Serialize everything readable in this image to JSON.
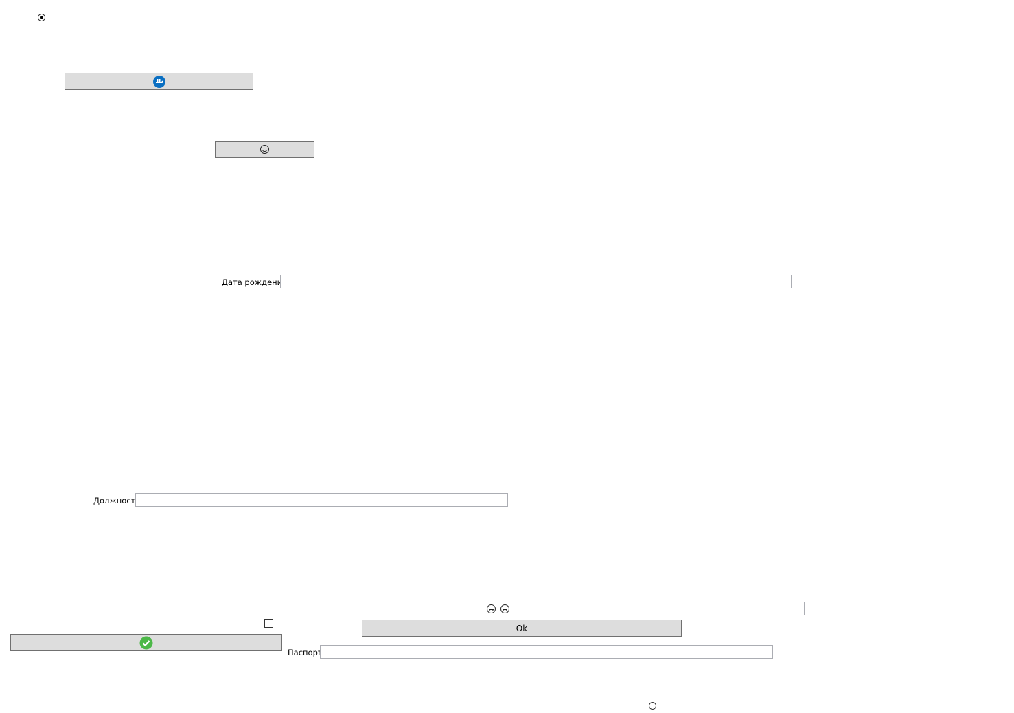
{
  "radios": [
    {
      "checked": true
    },
    {
      "checked": false
    }
  ],
  "checkbox": {
    "checked": false
  },
  "buttons": {
    "refresh": {
      "icon": "refresh-icon",
      "color": "#0a6fc2"
    },
    "emoji_button": {
      "icon": "laughing-emoji-icon"
    },
    "ok": {
      "label": "Ok"
    },
    "confirm": {
      "icon": "check-circle-icon",
      "color": "#4cb848"
    }
  },
  "fields": {
    "birth_date": {
      "label": "Дата рождения",
      "value": ""
    },
    "position": {
      "label": "Должность",
      "value": ""
    },
    "passport": {
      "label": "Паспорт",
      "value": ""
    },
    "emoji_field": {
      "value": "",
      "icons": [
        "laughing-emoji-icon",
        "grinning-emoji-icon"
      ]
    }
  }
}
